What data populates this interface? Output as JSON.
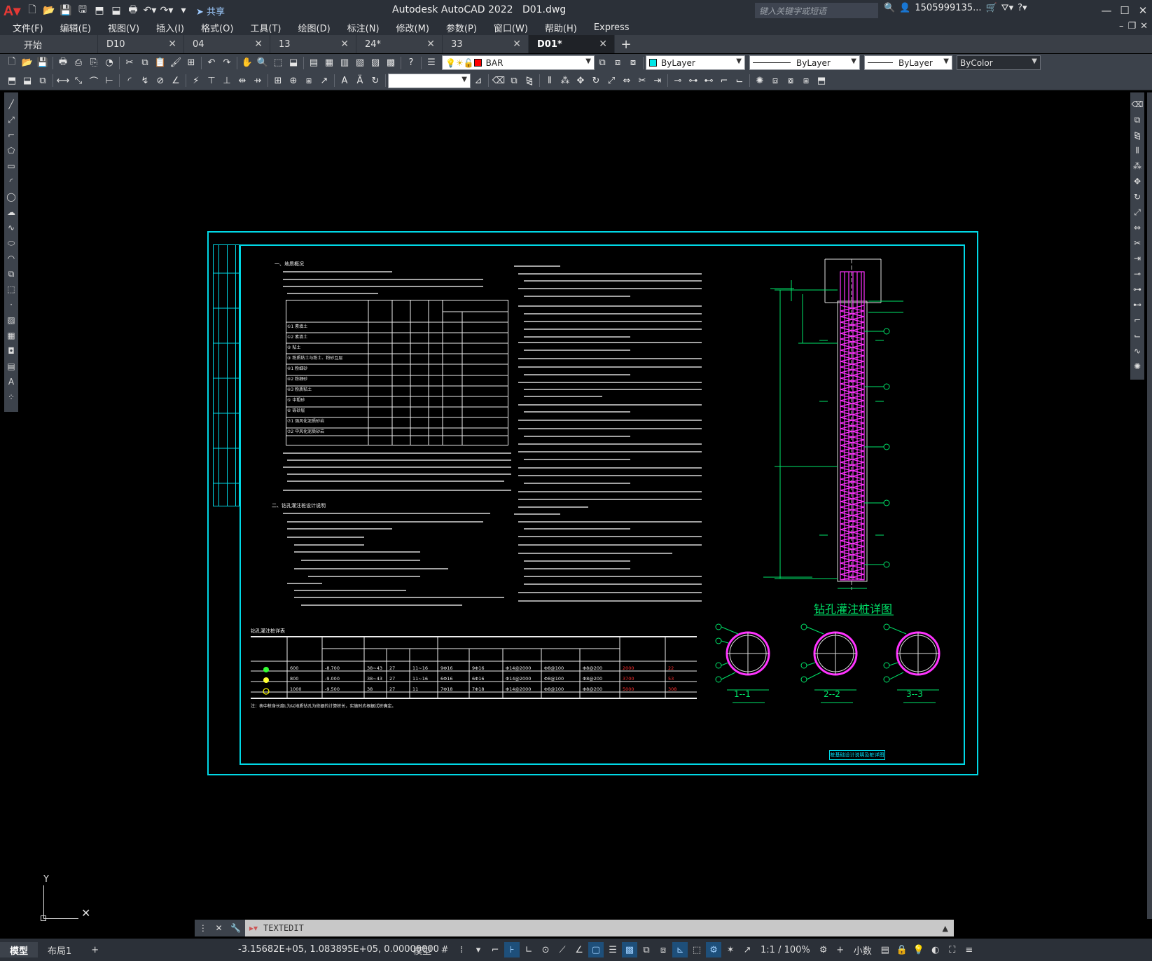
{
  "titlebar": {
    "app": "Autodesk AutoCAD 2022",
    "file": "D01.dwg",
    "share_label": "共享",
    "search_placeholder": "键入关键字或短语",
    "user": "1505999135...",
    "quick_access_icons": [
      "new-icon",
      "open-icon",
      "save-icon",
      "save-as-icon",
      "open-from-web-icon",
      "save-to-web-icon",
      "plot-icon",
      "undo-icon",
      "redo-icon",
      "workspace-dropdown-icon"
    ]
  },
  "menu": [
    "文件(F)",
    "编辑(E)",
    "视图(V)",
    "插入(I)",
    "格式(O)",
    "工具(T)",
    "绘图(D)",
    "标注(N)",
    "修改(M)",
    "参数(P)",
    "窗口(W)",
    "帮助(H)",
    "Express"
  ],
  "tabs": [
    {
      "label": "开始",
      "close": ""
    },
    {
      "label": "D10",
      "close": "✕"
    },
    {
      "label": "04",
      "close": "✕"
    },
    {
      "label": "13",
      "close": "✕"
    },
    {
      "label": "24*",
      "close": "✕"
    },
    {
      "label": "33",
      "close": "✕"
    },
    {
      "label": "D01*",
      "close": "✕"
    }
  ],
  "tab_add": "+",
  "layers": {
    "current_layer": "BAR",
    "layer_color": "#ff0000",
    "color_prop": "ByLayer",
    "color_prop_swatch": "#00e6e6",
    "linetype_prop": "ByLayer",
    "lineweight_prop": "ByLayer",
    "plotstyle_prop": "ByColor"
  },
  "drawing": {
    "notes_title_1": "一、地质概况",
    "notes_title_2": "二、钻孔灌注桩设计说明",
    "pile_table_title": "钻孔灌注桩详表",
    "pile_detail_title": "钻孔灌注桩详图",
    "section_1": "1--1",
    "section_2": "2--2",
    "section_3": "3--3",
    "title_block_label": "桩基础设计说明及桩详图",
    "table_note": "注：表中桩身长度L为以地质钻孔为依据的计算桩长，实施时应根据试桩确定。",
    "pile_rows": [
      {
        "d": "600",
        "top": "-8.700",
        "l": "38~43",
        "l1": "27",
        "l2": "11~16",
        "main": "9Φ16",
        "sub": "9Φ16",
        "hoop": "Φ14@2000",
        "spiral": "Φ8@100",
        "dense": "Φ8@200",
        "cap": "2000",
        "count": "22",
        "mark_color": "#33ff33"
      },
      {
        "d": "800",
        "top": "-9.000",
        "l": "38~43",
        "l1": "27",
        "l2": "11~16",
        "main": "6Φ16",
        "sub": "6Φ16",
        "hoop": "Φ14@2000",
        "spiral": "Φ8@100",
        "dense": "Φ8@200",
        "cap": "3700",
        "count": "53",
        "mark_color": "#ffff33"
      },
      {
        "d": "1000",
        "top": "-9.500",
        "l": "38",
        "l1": "27",
        "l2": "11",
        "main": "7Φ18",
        "sub": "7Φ18",
        "hoop": "Φ14@2000",
        "spiral": "Φ8@100",
        "dense": "Φ8@200",
        "cap": "5000",
        "count": "308",
        "mark_color": "#ffff00"
      }
    ],
    "soil_rows": [
      "素填土",
      "素填土",
      "粘土",
      "粉质粘土与粉土、粉砂互层",
      "粉细砂",
      "粉细砂",
      "粉质粘土",
      "中粗砂",
      "砾砂层",
      "强风化泥质砂岩",
      "中风化泥质砂岩"
    ],
    "soil_ids": [
      "①1",
      "①2",
      "②",
      "③",
      "④1",
      "④2",
      "④3",
      "⑤",
      "⑥",
      "⑦1",
      "⑦2"
    ]
  },
  "command": {
    "prompt": "TEXTEDIT"
  },
  "status": {
    "layout_tabs": [
      "模型",
      "布局1"
    ],
    "add_layout": "+",
    "coords": "-3.15682E+05, 1.083895E+05, 0.00000000",
    "model_label": "模型",
    "scale": "1:1 / 100%",
    "units": "小数"
  }
}
